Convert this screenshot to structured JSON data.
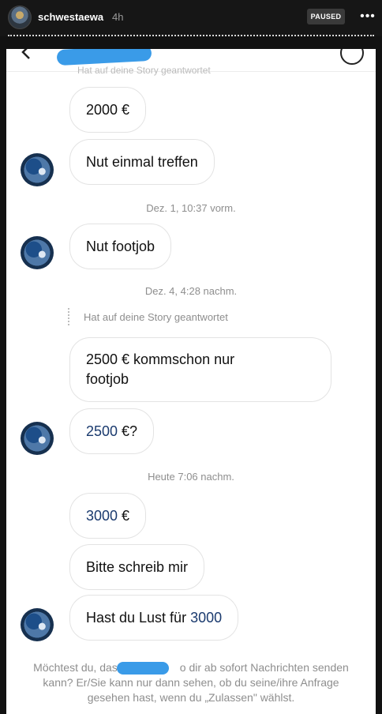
{
  "story": {
    "username": "schwestaewa",
    "time": "4h",
    "paused_label": "PAUSED",
    "more_icon": "more-horizontal-icon"
  },
  "chat": {
    "faded_reply": "Hat auf deine Story geantwortet",
    "messages": [
      {
        "text": "2000 €"
      },
      {
        "text": "Nut einmal treffen"
      },
      {
        "timestamp": "Dez. 1, 10:37 vorm."
      },
      {
        "text": "Nut footjob"
      },
      {
        "timestamp": "Dez. 4, 4:28 nachm."
      },
      {
        "reply": "Hat auf deine Story geantwortet"
      },
      {
        "text_line1": "2500 € kommschon  nur",
        "text_line2": "footjob"
      },
      {
        "num": "2500",
        "rest": " €?"
      },
      {
        "timestamp": "Heute 7:06 nachm."
      },
      {
        "num": "3000",
        "rest": " €"
      },
      {
        "text": "Bitte schreib mir"
      },
      {
        "prefix": "Hast du Lust für ",
        "num": "3000"
      }
    ],
    "footer": {
      "line1_a": "Möchtest du, dass",
      "line1_b": "o dir ab sofort Nachrichten senden",
      "line2": "kann? Er/Sie kann nur dann sehen, ob du seine/ihre Anfrage",
      "line3": "gesehen hast, wenn du „Zulassen\" wählst."
    }
  },
  "colors": {
    "accent_blue": "#3a9be8",
    "number_blue": "#1a3a6e"
  }
}
